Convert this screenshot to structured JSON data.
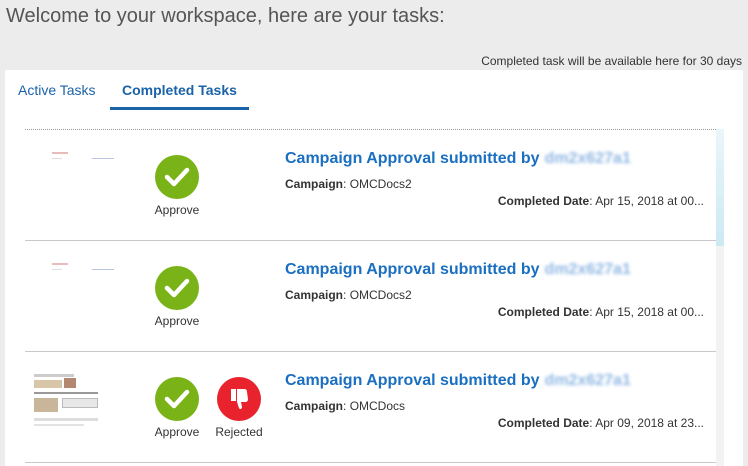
{
  "header": {
    "welcome": "Welcome to your workspace, here are your tasks:",
    "retention_note": "Completed task will be available here for 30 days"
  },
  "tabs": [
    {
      "label": "Active Tasks",
      "active": false
    },
    {
      "label": "Completed Tasks",
      "active": true
    }
  ],
  "labels": {
    "campaign": "Campaign",
    "completed_date": "Completed Date",
    "approve": "Approve",
    "rejected": "Rejected"
  },
  "tasks": [
    {
      "title": "Campaign Approval submitted by",
      "user": "dm2x627a1",
      "campaign": "OMCDocs2",
      "completed_date": "Apr 15, 2018 at 00...",
      "statuses": [
        "Approve"
      ]
    },
    {
      "title": "Campaign Approval submitted by",
      "user": "dm2x627a1",
      "campaign": "OMCDocs2",
      "completed_date": "Apr 15, 2018 at 00...",
      "statuses": [
        "Approve"
      ]
    },
    {
      "title": "Campaign Approval submitted by",
      "user": "dm2x627a1",
      "campaign": "OMCDocs",
      "completed_date": "Apr 09, 2018 at 23...",
      "statuses": [
        "Approve",
        "Rejected"
      ]
    }
  ],
  "icons": {
    "approve": "checkmark-icon",
    "reject": "thumbs-down-icon"
  },
  "colors": {
    "link": "#1a6fc0",
    "approve": "#7ab317",
    "reject": "#e8232d"
  }
}
